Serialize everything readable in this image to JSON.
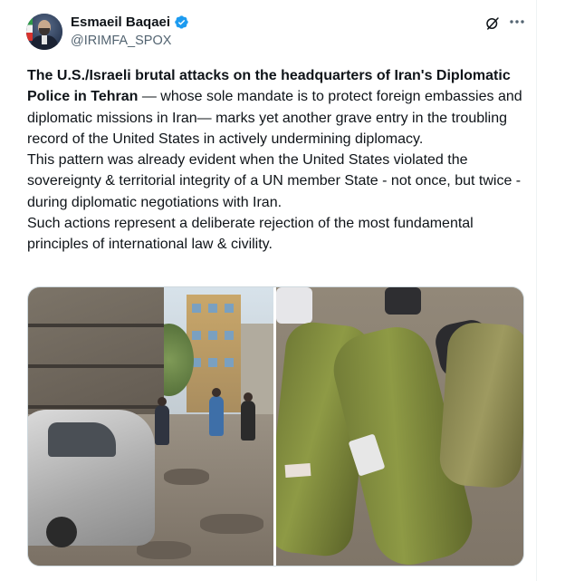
{
  "author": {
    "name": "Esmaeil Baqaei",
    "handle": "@IRIMFA_SPOX",
    "verified": true,
    "verified_color": "#1d9bf0"
  },
  "tweet": {
    "headline_bold": "The U.S./Israeli brutal attacks on the headquarters of Iran's Diplomatic Police in Tehran",
    "paragraph1_rest": " — whose sole mandate is to protect foreign embassies and diplomatic missions in Iran— marks yet another grave entry in the troubling record of the United States in actively undermining diplomacy.",
    "paragraph2": "This pattern was already evident when the United States violated the sovereignty & territorial integrity of a UN member State - not once, but twice - during diplomatic negotiations with Iran.",
    "paragraph3": "Such actions represent a deliberate rejection of the most fundamental principles of international law & civility."
  },
  "icons": {
    "grok": "grok-icon",
    "more": "more-options-icon",
    "verified": "verified-badge-icon"
  },
  "colors": {
    "text_primary": "#0f1419",
    "text_secondary": "#536471",
    "border": "#cfd9de"
  }
}
